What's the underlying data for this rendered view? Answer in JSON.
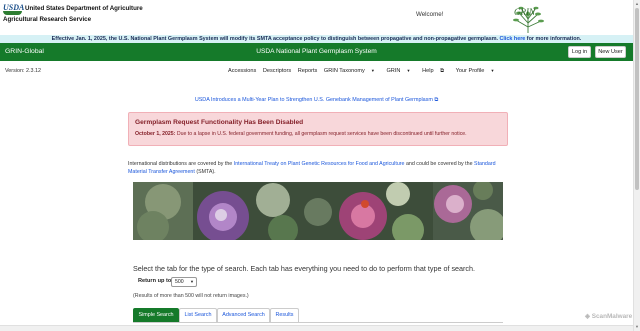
{
  "header": {
    "usda_logo_text": "USDA",
    "org_line1": "United States Department of Agriculture",
    "org_line2": "Agricultural Research Service",
    "welcome": "Welcome!",
    "grin_logo_text": "GRIN"
  },
  "notice": {
    "text": "Effective Jan. 1, 2025, the U.S. National Plant Germplasm System will modify its SMTA acceptance policy to distinguish between propagative and non-propagative germplasm.",
    "link": "Click here",
    "suffix": "for more information."
  },
  "navbar": {
    "brand": "GRIN-Global",
    "title": "USDA National Plant Germplasm System",
    "login": "Log in",
    "new_user": "New User"
  },
  "subnav": {
    "version": "Version: 2.3.12",
    "menu": [
      "Accessions",
      "Descriptors",
      "Reports",
      "GRIN Taxonomy",
      "GRIN",
      "Help",
      "Your Profile"
    ]
  },
  "announcement": "USDA Introduces a Multi-Year Plan to Strengthen U.S. Genebank Management of Plant Germplasm",
  "alert": {
    "title": "Germplasm Request Functionality Has Been Disabled",
    "date": "October 1, 2025:",
    "body": "Due to a lapse in U.S. federal government funding, all germplasm request services have been discontinued until further notice."
  },
  "distribution": {
    "pre": "International distributions are covered by the",
    "link1": "International Treaty on Plant Genetic Resources for Food and Agriculture",
    "mid": "and could be covered by the",
    "link2": "Standard Material Transfer Agreement",
    "post": "(SMTA)."
  },
  "search": {
    "instruction": "Select the tab for the type of search. Each tab has everything you need to do to perform that type of search.",
    "return_label": "Return up to",
    "return_value": "500",
    "note": "(Results of more than 500 will not return images.)",
    "tabs": [
      "Simple Search",
      "List Search",
      "Advanced Search",
      "Results"
    ]
  },
  "watermark": "ScanMalware",
  "colors": {
    "nav_green": "#157a2a",
    "notice_bg": "#d6f1f5",
    "alert_bg": "#f8d7da",
    "link_blue": "#1a56db"
  }
}
